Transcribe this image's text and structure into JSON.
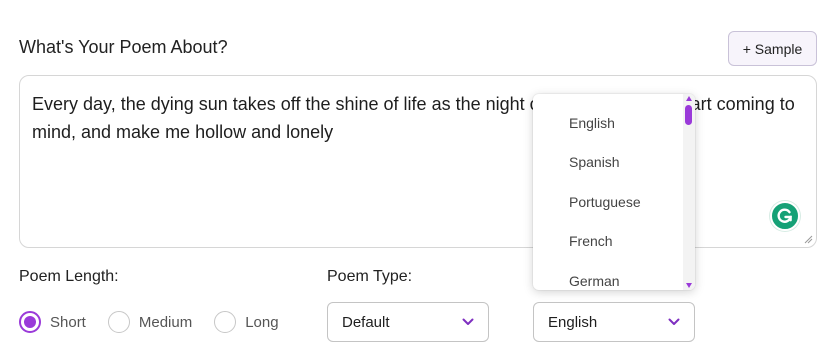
{
  "form": {
    "heading": "What's Your Poem About?",
    "sample_button": "+ Sample",
    "poem_text": "Every day, the dying sun takes off the shine of life as the night comes, memories start coming to mind, and make me hollow and lonely"
  },
  "length": {
    "label": "Poem Length:",
    "options": [
      {
        "label": "Short",
        "checked": true
      },
      {
        "label": "Medium",
        "checked": false
      },
      {
        "label": "Long",
        "checked": false
      }
    ]
  },
  "type": {
    "label": "Poem Type:",
    "selected": "Default"
  },
  "language": {
    "selected": "English",
    "options": [
      "English",
      "Spanish",
      "Portuguese",
      "French",
      "German"
    ]
  },
  "colors": {
    "accent": "#9a3ad9",
    "grammarly": "#15a176"
  },
  "icons": {
    "grammarly": "grammarly-icon",
    "chevron": "chevron-down-icon",
    "resize": "resize-grip-icon"
  }
}
